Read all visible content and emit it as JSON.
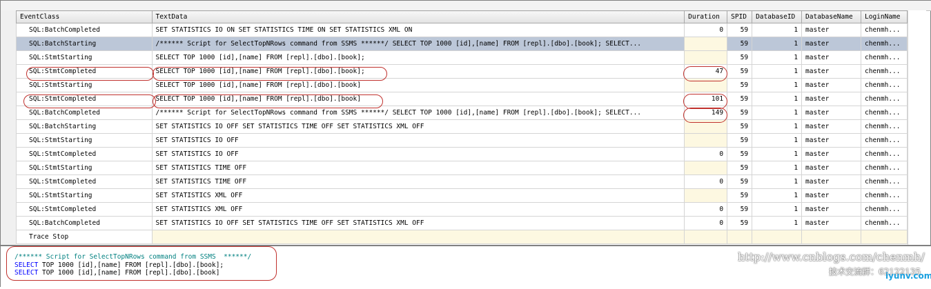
{
  "columns": [
    "EventClass",
    "TextData",
    "Duration",
    "SPID",
    "DatabaseID",
    "DatabaseName",
    "LoginName"
  ],
  "rows": [
    {
      "event": "SQL:BatchCompleted",
      "text": "SET STATISTICS IO ON SET STATISTICS TIME ON SET STATISTICS XML ON",
      "duration": "0",
      "spid": "59",
      "dbid": "1",
      "dbname": "master",
      "login": "chenmh..."
    },
    {
      "event": "SQL:BatchStarting",
      "text": "/****** Script for SelectTopNRows command from SSMS  ******/  SELECT TOP 1000 [id],[name] FROM [repl].[dbo].[book];  SELECT...",
      "duration": "",
      "spid": "59",
      "dbid": "1",
      "dbname": "master",
      "login": "chenmh..."
    },
    {
      "event": "SQL:StmtStarting",
      "text": "SELECT TOP 1000 [id],[name] FROM [repl].[dbo].[book];",
      "duration": "",
      "spid": "59",
      "dbid": "1",
      "dbname": "master",
      "login": "chenmh..."
    },
    {
      "event": "SQL:StmtCompleted",
      "text": "SELECT TOP 1000 [id],[name] FROM [repl].[dbo].[book];",
      "duration": "47",
      "spid": "59",
      "dbid": "1",
      "dbname": "master",
      "login": "chenmh..."
    },
    {
      "event": "SQL:StmtStarting",
      "text": "SELECT TOP 1000 [id],[name] FROM [repl].[dbo].[book]",
      "duration": "",
      "spid": "59",
      "dbid": "1",
      "dbname": "master",
      "login": "chenmh..."
    },
    {
      "event": "SQL:StmtCompleted",
      "text": "SELECT TOP 1000 [id],[name] FROM [repl].[dbo].[book]",
      "duration": "101",
      "spid": "59",
      "dbid": "1",
      "dbname": "master",
      "login": "chenmh..."
    },
    {
      "event": "SQL:BatchCompleted",
      "text": "/****** Script for SelectTopNRows command from SSMS  ******/  SELECT TOP 1000 [id],[name] FROM [repl].[dbo].[book];  SELECT...",
      "duration": "149",
      "spid": "59",
      "dbid": "1",
      "dbname": "master",
      "login": "chenmh..."
    },
    {
      "event": "SQL:BatchStarting",
      "text": "SET STATISTICS IO OFF SET STATISTICS TIME OFF SET STATISTICS XML OFF",
      "duration": "",
      "spid": "59",
      "dbid": "1",
      "dbname": "master",
      "login": "chenmh..."
    },
    {
      "event": "SQL:StmtStarting",
      "text": "SET STATISTICS IO OFF",
      "duration": "",
      "spid": "59",
      "dbid": "1",
      "dbname": "master",
      "login": "chenmh..."
    },
    {
      "event": "SQL:StmtCompleted",
      "text": "SET STATISTICS IO OFF",
      "duration": "0",
      "spid": "59",
      "dbid": "1",
      "dbname": "master",
      "login": "chenmh..."
    },
    {
      "event": "SQL:StmtStarting",
      "text": "SET STATISTICS TIME OFF",
      "duration": "",
      "spid": "59",
      "dbid": "1",
      "dbname": "master",
      "login": "chenmh..."
    },
    {
      "event": "SQL:StmtCompleted",
      "text": "SET STATISTICS TIME OFF",
      "duration": "0",
      "spid": "59",
      "dbid": "1",
      "dbname": "master",
      "login": "chenmh..."
    },
    {
      "event": "SQL:StmtStarting",
      "text": "SET STATISTICS XML OFF",
      "duration": "",
      "spid": "59",
      "dbid": "1",
      "dbname": "master",
      "login": "chenmh..."
    },
    {
      "event": "SQL:StmtCompleted",
      "text": "SET STATISTICS XML OFF",
      "duration": "0",
      "spid": "59",
      "dbid": "1",
      "dbname": "master",
      "login": "chenmh..."
    },
    {
      "event": "SQL:BatchCompleted",
      "text": "SET STATISTICS IO OFF SET STATISTICS TIME OFF SET STATISTICS XML OFF",
      "duration": "0",
      "spid": "59",
      "dbid": "1",
      "dbname": "master",
      "login": "chenmh..."
    }
  ],
  "trace_stop_label": "Trace Stop",
  "selected_row": 1,
  "sql_pane": {
    "comment": "/****** Script for SelectTopNRows command from SSMS  ******/",
    "line1_kw": "SELECT",
    "line1_rest": " TOP 1000 [id],[name] FROM [repl].[dbo].[book];",
    "line2_kw": "SELECT",
    "line2_rest": " TOP 1000 [id],[name] FROM [repl].[dbo].[book]"
  },
  "watermark": {
    "url": "http://www.cnblogs.com/chenmh/",
    "group": "技术交流群：62122135",
    "logo": "iyunv.com"
  },
  "colors": {
    "selected_row": "#bcc7d8",
    "annotation": "#c0302c",
    "sql_keyword": "#0000ff",
    "sql_comment": "#008080"
  }
}
